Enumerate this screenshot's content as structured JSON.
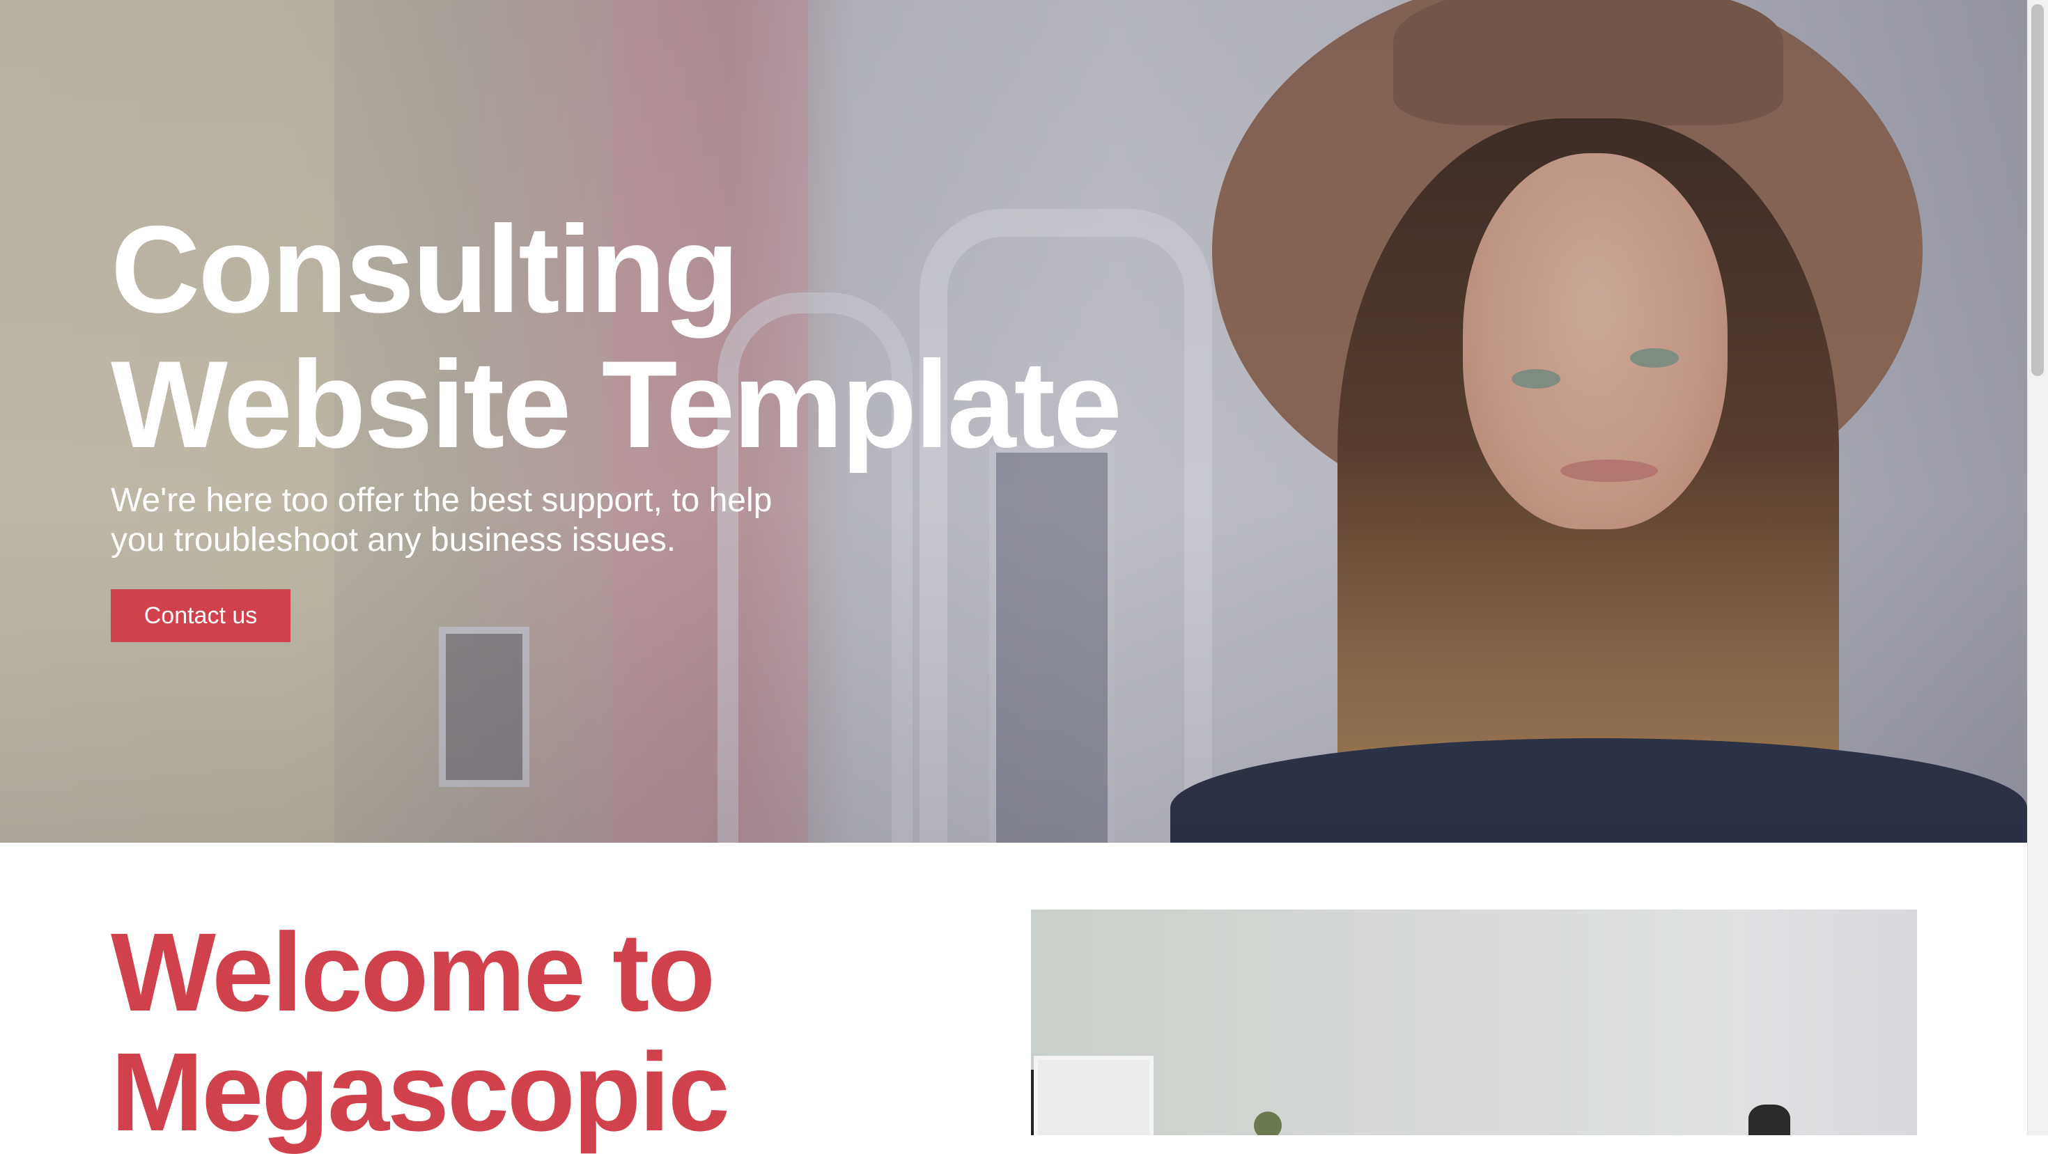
{
  "hero": {
    "title": "Consulting Website Template",
    "subtitle": "We're here too offer the best support, to help you troubleshoot any business issues.",
    "cta_label": "Contact us"
  },
  "about": {
    "heading": "Welcome to Megascopic"
  },
  "colors": {
    "accent": "#d1414b",
    "hero_text": "#ffffff"
  }
}
